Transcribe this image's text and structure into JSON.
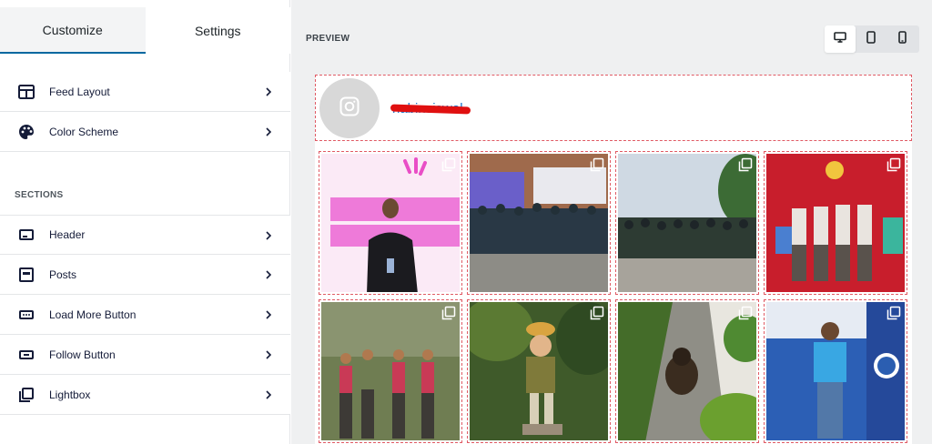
{
  "sidebar": {
    "tabs": [
      {
        "label": "Customize"
      },
      {
        "label": "Settings"
      }
    ],
    "top_items": [
      {
        "label": "Feed Layout",
        "icon": "feed-layout-icon"
      },
      {
        "label": "Color Scheme",
        "icon": "palette-icon"
      }
    ],
    "section_title": "SECTIONS",
    "section_items": [
      {
        "label": "Header",
        "icon": "header-icon"
      },
      {
        "label": "Posts",
        "icon": "posts-icon"
      },
      {
        "label": "Load More Button",
        "icon": "load-more-icon"
      },
      {
        "label": "Follow Button",
        "icon": "follow-button-icon"
      },
      {
        "label": "Lightbox",
        "icon": "lightbox-icon"
      }
    ]
  },
  "preview": {
    "title": "PREVIEW",
    "devices": [
      "desktop",
      "tablet",
      "mobile"
    ],
    "active_device": "desktop",
    "feed": {
      "username": "nabinsiswal",
      "posts": [
        {
          "description": "speaker in black shirt on stage, pink slide"
        },
        {
          "description": "group photo of volunteers"
        },
        {
          "description": "group photo outdoors on stone paving"
        },
        {
          "description": "group with WordCamp red banner"
        },
        {
          "description": "hikers group on trail"
        },
        {
          "description": "painted statue in garden"
        },
        {
          "description": "dog sitting beside white wall"
        },
        {
          "description": "speaker at WordCamp Nepal banner"
        }
      ]
    }
  },
  "colors": {
    "accent": "#0068a0",
    "link": "#1a73c9",
    "dashed_outline": "#e05a64"
  }
}
